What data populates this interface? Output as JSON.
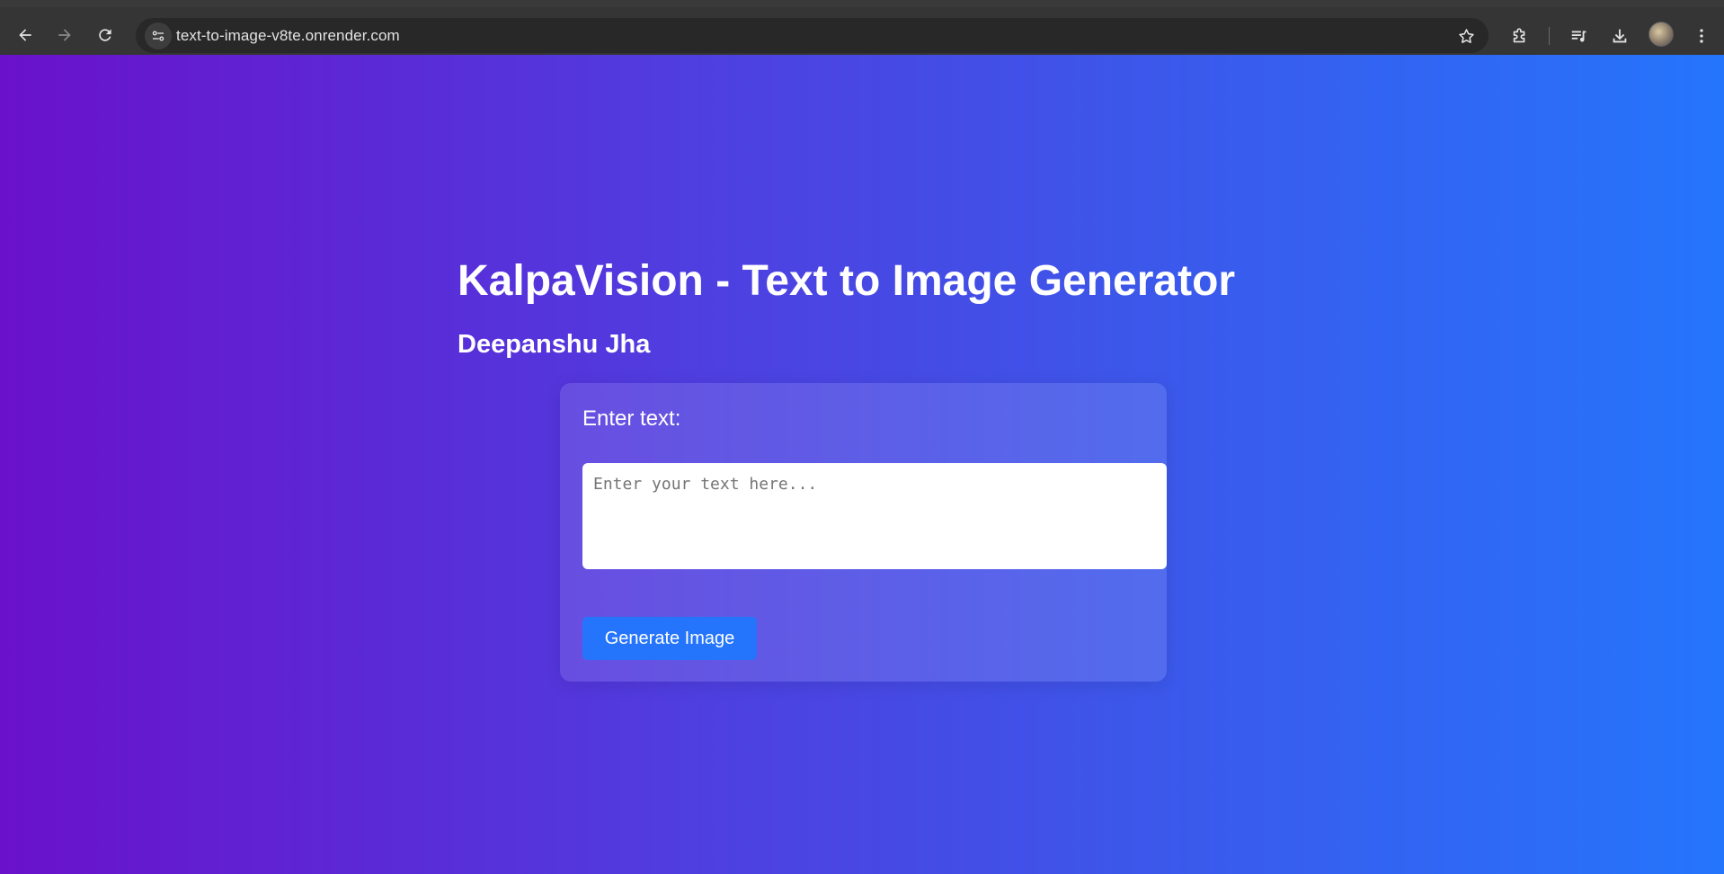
{
  "browser": {
    "url": "text-to-image-v8te.onrender.com",
    "icons": {
      "back": "arrow-left-icon",
      "forward": "arrow-right-icon",
      "reload": "reload-icon",
      "site_info": "tune-icon",
      "bookmark": "star-icon",
      "extensions": "puzzle-icon",
      "media": "playlist-icon",
      "downloads": "download-icon",
      "menu": "kebab-menu-icon"
    }
  },
  "page": {
    "title": "KalpaVision - Text to Image Generator",
    "author": "Deepanshu Jha",
    "form": {
      "label": "Enter text:",
      "input_value": "",
      "input_placeholder": "Enter your text here...",
      "button_label": "Generate Image"
    }
  },
  "colors": {
    "gradient_start": "#6a11cb",
    "gradient_end": "#2575fc",
    "button": "#2575fc",
    "chrome": "#353535",
    "omnibox": "#282828"
  }
}
